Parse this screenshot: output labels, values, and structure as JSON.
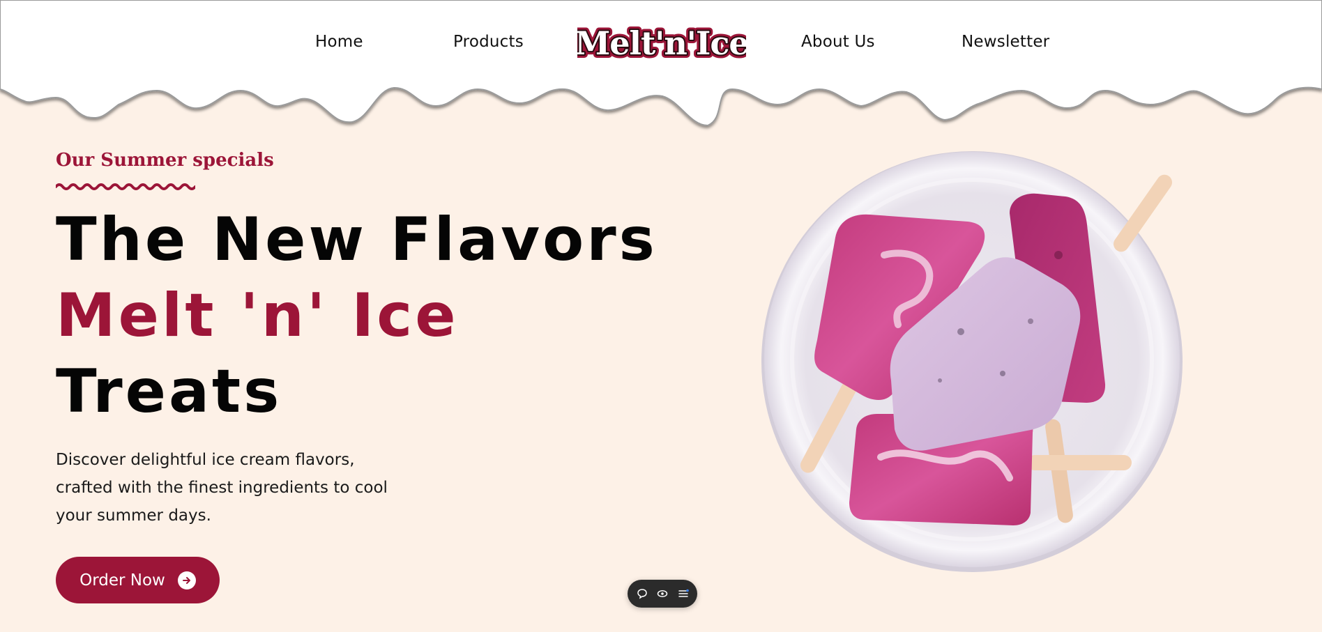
{
  "nav": {
    "links": [
      "Home",
      "Products",
      "About Us",
      "Newsletter"
    ],
    "logo_text": "Melt'n'Ice"
  },
  "hero": {
    "eyebrow": "Our Summer specials",
    "headline_line1": "The New Flavors",
    "headline_line2": "Melt 'n' Ice",
    "headline_line3": "Treats",
    "description": "Discover delightful ice cream flavors, crafted with the finest ingredients to cool your summer days.",
    "cta_label": "Order Now"
  },
  "toolbar": {
    "icons": [
      "comment-icon",
      "eye-icon",
      "menu-icon"
    ]
  },
  "colors": {
    "brand": "#9c1538",
    "background": "#fdf1e7",
    "text": "#050505"
  }
}
